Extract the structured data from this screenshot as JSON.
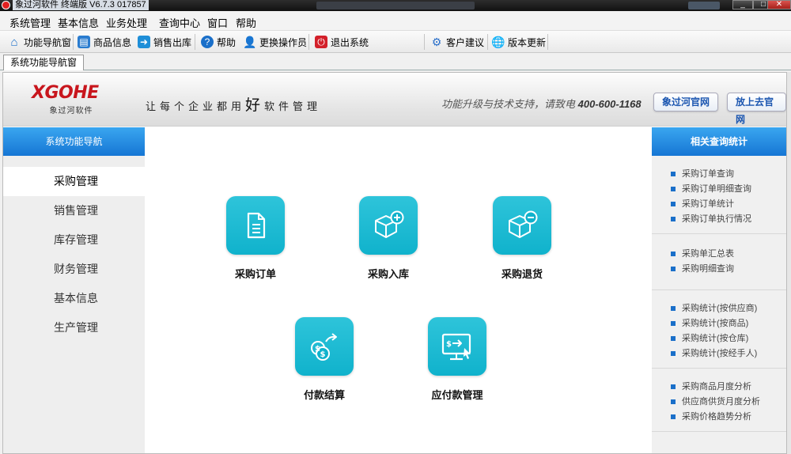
{
  "window": {
    "title": "象过河软件   终端版 V6.7.3   017857"
  },
  "menu": [
    "系统管理",
    "基本信息",
    "业务处理",
    "查询中心",
    "窗口",
    "帮助"
  ],
  "toolbar": [
    {
      "label": "功能导航窗",
      "icon": "home-icon"
    },
    {
      "label": "商品信息",
      "icon": "product-icon"
    },
    {
      "label": "销售出库",
      "icon": "sales-out-icon"
    },
    {
      "label": "帮助",
      "icon": "help-icon"
    },
    {
      "label": "更换操作员",
      "icon": "switch-user-icon"
    },
    {
      "label": "退出系统",
      "icon": "exit-icon"
    },
    {
      "label": "客户建议",
      "icon": "suggestion-icon"
    },
    {
      "label": "版本更新",
      "icon": "update-icon"
    }
  ],
  "tab": {
    "label": "系统功能导航窗"
  },
  "header": {
    "logo": "XGOHE",
    "logo_sub": "象过河软件",
    "slogan_pre": "让每个企业都用",
    "slogan_big": "好",
    "slogan_post": "软件管理",
    "support_text": "功能升级与技术支持，请致电",
    "support_phone": "400-600-1168",
    "btn_official": "象过河官网",
    "btn_goto": "放上去官网"
  },
  "left_nav": {
    "title": "系统功能导航",
    "items": [
      "采购管理",
      "销售管理",
      "库存管理",
      "财务管理",
      "基本信息",
      "生产管理"
    ],
    "active": "采购管理"
  },
  "tiles": [
    {
      "label": "采购订单",
      "icon": "document-icon"
    },
    {
      "label": "采购入库",
      "icon": "box-plus-icon"
    },
    {
      "label": "采购退货",
      "icon": "box-minus-icon"
    },
    {
      "label": "付款结算",
      "icon": "coins-transfer-icon"
    },
    {
      "label": "应付款管理",
      "icon": "monitor-payment-icon"
    }
  ],
  "right_panel": {
    "title": "相关查询统计",
    "groups": [
      [
        "采购订单查询",
        "采购订单明细查询",
        "采购订单统计",
        "采购订单执行情况"
      ],
      [
        "采购单汇总表",
        "采购明细查询"
      ],
      [
        "采购统计(按供应商)",
        "采购统计(按商品)",
        "采购统计(按仓库)",
        "采购统计(按经手人)"
      ],
      [
        "采购商品月度分析",
        "供应商供货月度分析",
        "采购价格趋势分析"
      ]
    ]
  },
  "colors": {
    "accent_blue": "#1676d4",
    "tile_cyan": "#10b2cc",
    "logo_red": "#c8161d"
  }
}
